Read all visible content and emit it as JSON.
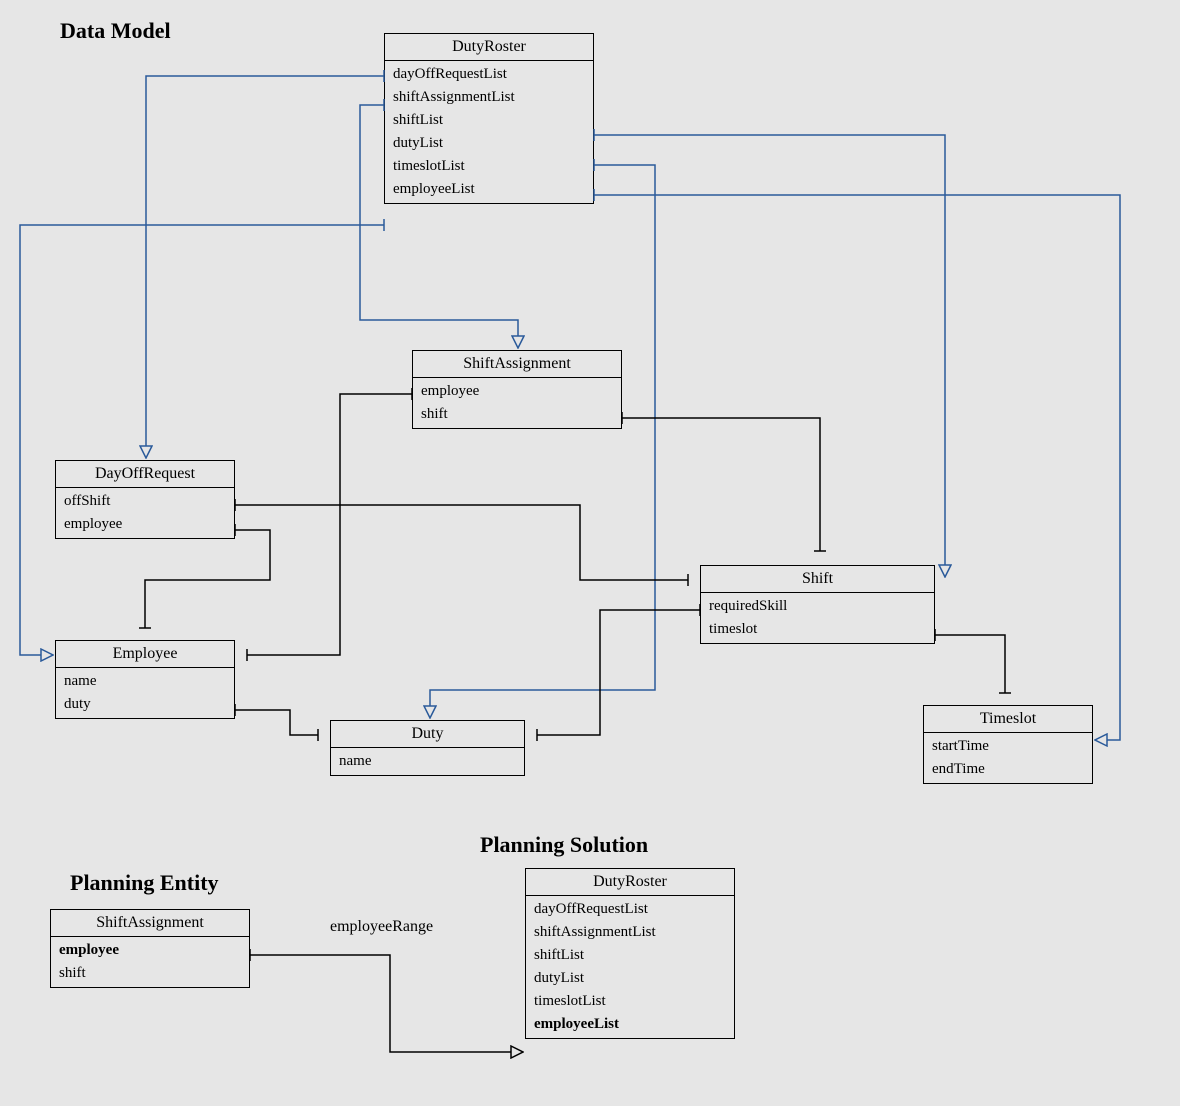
{
  "headings": {
    "data_model": "Data Model",
    "planning_entity": "Planning Entity",
    "planning_solution": "Planning Solution"
  },
  "entities": {
    "dutyRoster": {
      "name": "DutyRoster",
      "attrs": [
        "dayOffRequestList",
        "shiftAssignmentList",
        "shiftList",
        "dutyList",
        "timeslotList",
        "employeeList"
      ]
    },
    "shiftAssignment": {
      "name": "ShiftAssignment",
      "attrs": [
        "employee",
        "shift"
      ]
    },
    "dayOffRequest": {
      "name": "DayOffRequest",
      "attrs": [
        "offShift",
        "employee"
      ]
    },
    "employee": {
      "name": "Employee",
      "attrs": [
        "name",
        "duty"
      ]
    },
    "duty": {
      "name": "Duty",
      "attrs": [
        "name"
      ]
    },
    "shift": {
      "name": "Shift",
      "attrs": [
        "requiredSkill",
        "timeslot"
      ]
    },
    "timeslot": {
      "name": "Timeslot",
      "attrs": [
        "startTime",
        "endTime"
      ]
    },
    "planningShiftAssignment": {
      "name": "ShiftAssignment",
      "attrs": [
        "employee",
        "shift"
      ],
      "bold": [
        true,
        false
      ]
    },
    "planningDutyRoster": {
      "name": "DutyRoster",
      "attrs": [
        "dayOffRequestList",
        "shiftAssignmentList",
        "shiftList",
        "dutyList",
        "timeslotList",
        "employeeList"
      ],
      "bold": [
        false,
        false,
        false,
        false,
        false,
        true
      ]
    }
  },
  "edgeLabels": {
    "employeeRange": "employeeRange"
  },
  "chart_data": {
    "type": "diagram",
    "title": "Data Model",
    "classes": [
      {
        "name": "DutyRoster",
        "attributes": [
          "dayOffRequestList",
          "shiftAssignmentList",
          "shiftList",
          "dutyList",
          "timeslotList",
          "employeeList"
        ]
      },
      {
        "name": "ShiftAssignment",
        "attributes": [
          "employee",
          "shift"
        ]
      },
      {
        "name": "DayOffRequest",
        "attributes": [
          "offShift",
          "employee"
        ]
      },
      {
        "name": "Employee",
        "attributes": [
          "name",
          "duty"
        ]
      },
      {
        "name": "Duty",
        "attributes": [
          "name"
        ]
      },
      {
        "name": "Shift",
        "attributes": [
          "requiredSkill",
          "timeslot"
        ]
      },
      {
        "name": "Timeslot",
        "attributes": [
          "startTime",
          "endTime"
        ]
      }
    ],
    "relationships": [
      {
        "from": "DutyRoster.dayOffRequestList",
        "to": "DayOffRequest",
        "type": "aggregation-many"
      },
      {
        "from": "DutyRoster.shiftAssignmentList",
        "to": "ShiftAssignment",
        "type": "aggregation-many"
      },
      {
        "from": "DutyRoster.shiftList",
        "to": "Shift",
        "type": "aggregation-many"
      },
      {
        "from": "DutyRoster.dutyList",
        "to": "Duty",
        "type": "aggregation-many"
      },
      {
        "from": "DutyRoster.timeslotList",
        "to": "Timeslot",
        "type": "aggregation-many"
      },
      {
        "from": "DutyRoster.employeeList",
        "to": "Employee",
        "type": "aggregation-many"
      },
      {
        "from": "ShiftAssignment.employee",
        "to": "Employee",
        "type": "association"
      },
      {
        "from": "ShiftAssignment.shift",
        "to": "Shift",
        "type": "association"
      },
      {
        "from": "DayOffRequest.offShift",
        "to": "Shift",
        "type": "association"
      },
      {
        "from": "DayOffRequest.employee",
        "to": "Employee",
        "type": "association"
      },
      {
        "from": "Employee.duty",
        "to": "Duty",
        "type": "association"
      },
      {
        "from": "Shift.requiredSkill",
        "to": "Duty",
        "type": "association"
      },
      {
        "from": "Shift.timeslot",
        "to": "Timeslot",
        "type": "association"
      }
    ],
    "planning": {
      "entity": {
        "name": "ShiftAssignment",
        "planningVariable": "employee"
      },
      "solution": {
        "name": "DutyRoster",
        "valueRangeProvider": "employeeList"
      },
      "relationship": {
        "from": "ShiftAssignment.employee",
        "to": "DutyRoster.employeeList",
        "label": "employeeRange",
        "type": "aggregation-many"
      }
    }
  }
}
